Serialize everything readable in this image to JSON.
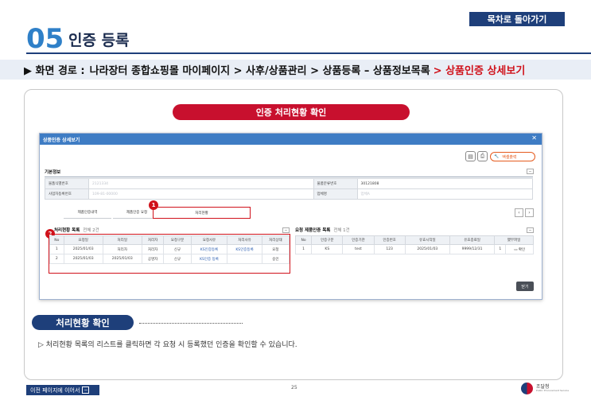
{
  "header": {
    "toc_button": "목차로 돌아가기",
    "section_number": "05",
    "section_title": "인증 등록"
  },
  "path": {
    "prefix": "▶ 화면 경로 :",
    "trail": "나라장터 종합쇼핑몰 마이페이지 > 사후/상품관리 > 상품등록 – 상품정보목록",
    "current": "> 상품인증 상세보기"
  },
  "card": {
    "title": "인증 처리현황 확인"
  },
  "dialog": {
    "title": "상품인증 상세보기",
    "close_glyph": "✕",
    "excel_button": "엑셀출력",
    "basic_info_label": "기본정보",
    "fields": [
      {
        "label": "물품식별번호",
        "value": "2121334",
        "label2": "물품분류번호",
        "value2": "30121808"
      },
      {
        "label": "사업자등록번호",
        "value": "109-81-00000",
        "label2": "업체명",
        "value2": "업체A"
      }
    ],
    "tabs": [
      "제품인증내역",
      "제품인증 요청",
      "처리현황"
    ],
    "left_section": {
      "label": "처리현황 목록",
      "count": "전체 2건",
      "columns": [
        "No",
        "요청일",
        "처리일",
        "처리자",
        "요청구분",
        "요청사유",
        "처리사유",
        "처리상태"
      ],
      "rows": [
        [
          "1",
          "2025/01/03",
          "처리자",
          "처리자",
          "신규",
          "KS인증등록",
          "KS인증등록",
          "요청"
        ],
        [
          "2",
          "2025/01/03",
          "2025/01/03",
          "공명자",
          "신규",
          "KS인증 등록",
          "",
          "승인"
        ]
      ]
    },
    "right_section": {
      "label": "요청 제품인증 목록",
      "count": "전체 1건",
      "columns": [
        "No",
        "인증구분",
        "인증기관",
        "인증번호",
        "유효시작일",
        "유효종료일",
        "했부파일"
      ],
      "rows": [
        [
          "1",
          "KS",
          "test",
          "123",
          "2025/01/03",
          "9999/12/31",
          "1",
          "확인"
        ]
      ]
    },
    "close_button": "닫기"
  },
  "markers": [
    "1",
    "2"
  ],
  "bottom": {
    "sub_title": "처리현황 확인",
    "description": "▷ 처리현황 목록의 리스트를 클릭하면 각 요청 시 등록했던 인증을 확인할 수 있습니다."
  },
  "footer": {
    "prev_link": "이전 페이지에 이어서",
    "page_number": "25",
    "logo_name": "조달청",
    "logo_sub": "Public Procurement Service"
  },
  "colors": {
    "navy": "#1e3f7a",
    "accent_red": "#c8102e",
    "dialog_header": "#3e7cc4",
    "section_number": "#2f80c8"
  }
}
